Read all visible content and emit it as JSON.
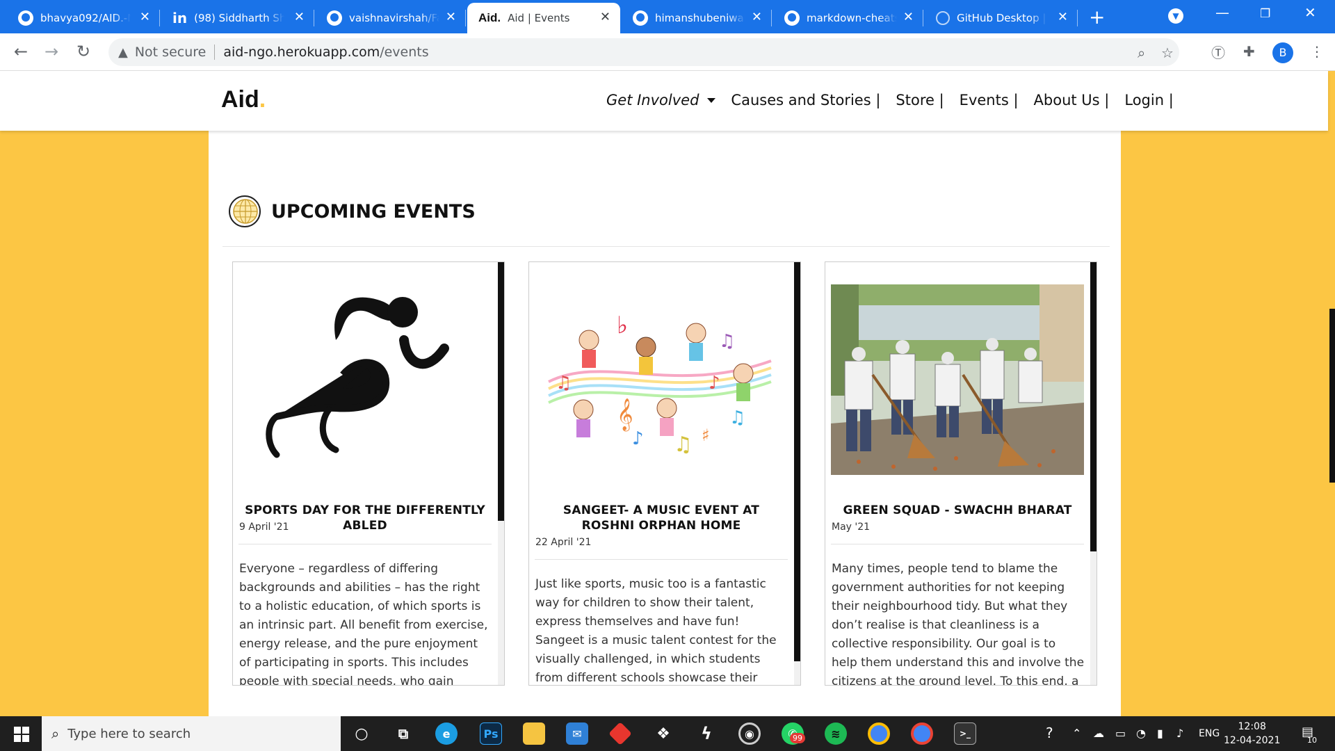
{
  "browser": {
    "tabs": [
      {
        "title": "bhavya092/AID.-N",
        "icon": "github-icon"
      },
      {
        "title": "(98) Siddharth Sha",
        "icon": "linkedin-icon"
      },
      {
        "title": "vaishnavirshah/Fa",
        "icon": "github-icon"
      },
      {
        "title": "Aid | Events",
        "icon": "aid-favicon",
        "favicon_text": "Aid.",
        "active": true
      },
      {
        "title": "himanshubeniwal/",
        "icon": "github-icon"
      },
      {
        "title": "markdown-cheats",
        "icon": "github-icon"
      },
      {
        "title": "GitHub Desktop |",
        "icon": "github-desktop-icon"
      }
    ],
    "security_label": "Not secure",
    "url_host": "aid-ngo.herokuapp.com",
    "url_path": "/events",
    "profile_initial": "B",
    "accent": "#1a73e8"
  },
  "site": {
    "logo": "Aid",
    "logo_dot": ".",
    "nav": {
      "get_involved": "Get Involved",
      "causes": "Causes and Stories |",
      "store": "Store |",
      "events": "Events |",
      "about": "About Us |",
      "login": "Login |"
    },
    "brand_color": "#fcc644",
    "section_title": "UPCOMING EVENTS",
    "events": [
      {
        "title": "SPORTS DAY FOR THE DIFFERENTLY ABLED",
        "date": "9 April '21",
        "image": "runner-pictogram",
        "description": "Everyone – regardless of differing backgrounds and abilities – has the right to a holistic education, of which sports is an intrinsic part. All benefit from exercise, energy release, and the pure enjoyment of participating in sports. This includes people with special needs, who gain considerable"
      },
      {
        "title": "SANGEET- A MUSIC EVENT AT ROSHNI ORPHAN HOME",
        "date": "22 April '21",
        "image": "children-music-notes-illustration",
        "description": "Just like sports, music too is a fantastic way for children to show their talent, express themselves and have fun! Sangeet is a music talent contest for the visually challenged, in which students from different schools showcase their singing and music talent"
      },
      {
        "title": "GREEN SQUAD - SWACHH BHARAT",
        "date": "May '21",
        "image": "street-cleaning-photo",
        "description": "Many times, people tend to blame the government authorities for not keeping their neighbourhood tidy. But what they don’t realise is that cleanliness is a collective responsibility. Our goal is to help them understand this and involve the citizens at the ground level. To this end, a group of Aid"
      }
    ]
  },
  "taskbar": {
    "search_placeholder": "Type here to search",
    "whatsapp_badge": "99",
    "language": "ENG",
    "time": "12:08",
    "date": "12-04-2021",
    "notifications": "10"
  }
}
